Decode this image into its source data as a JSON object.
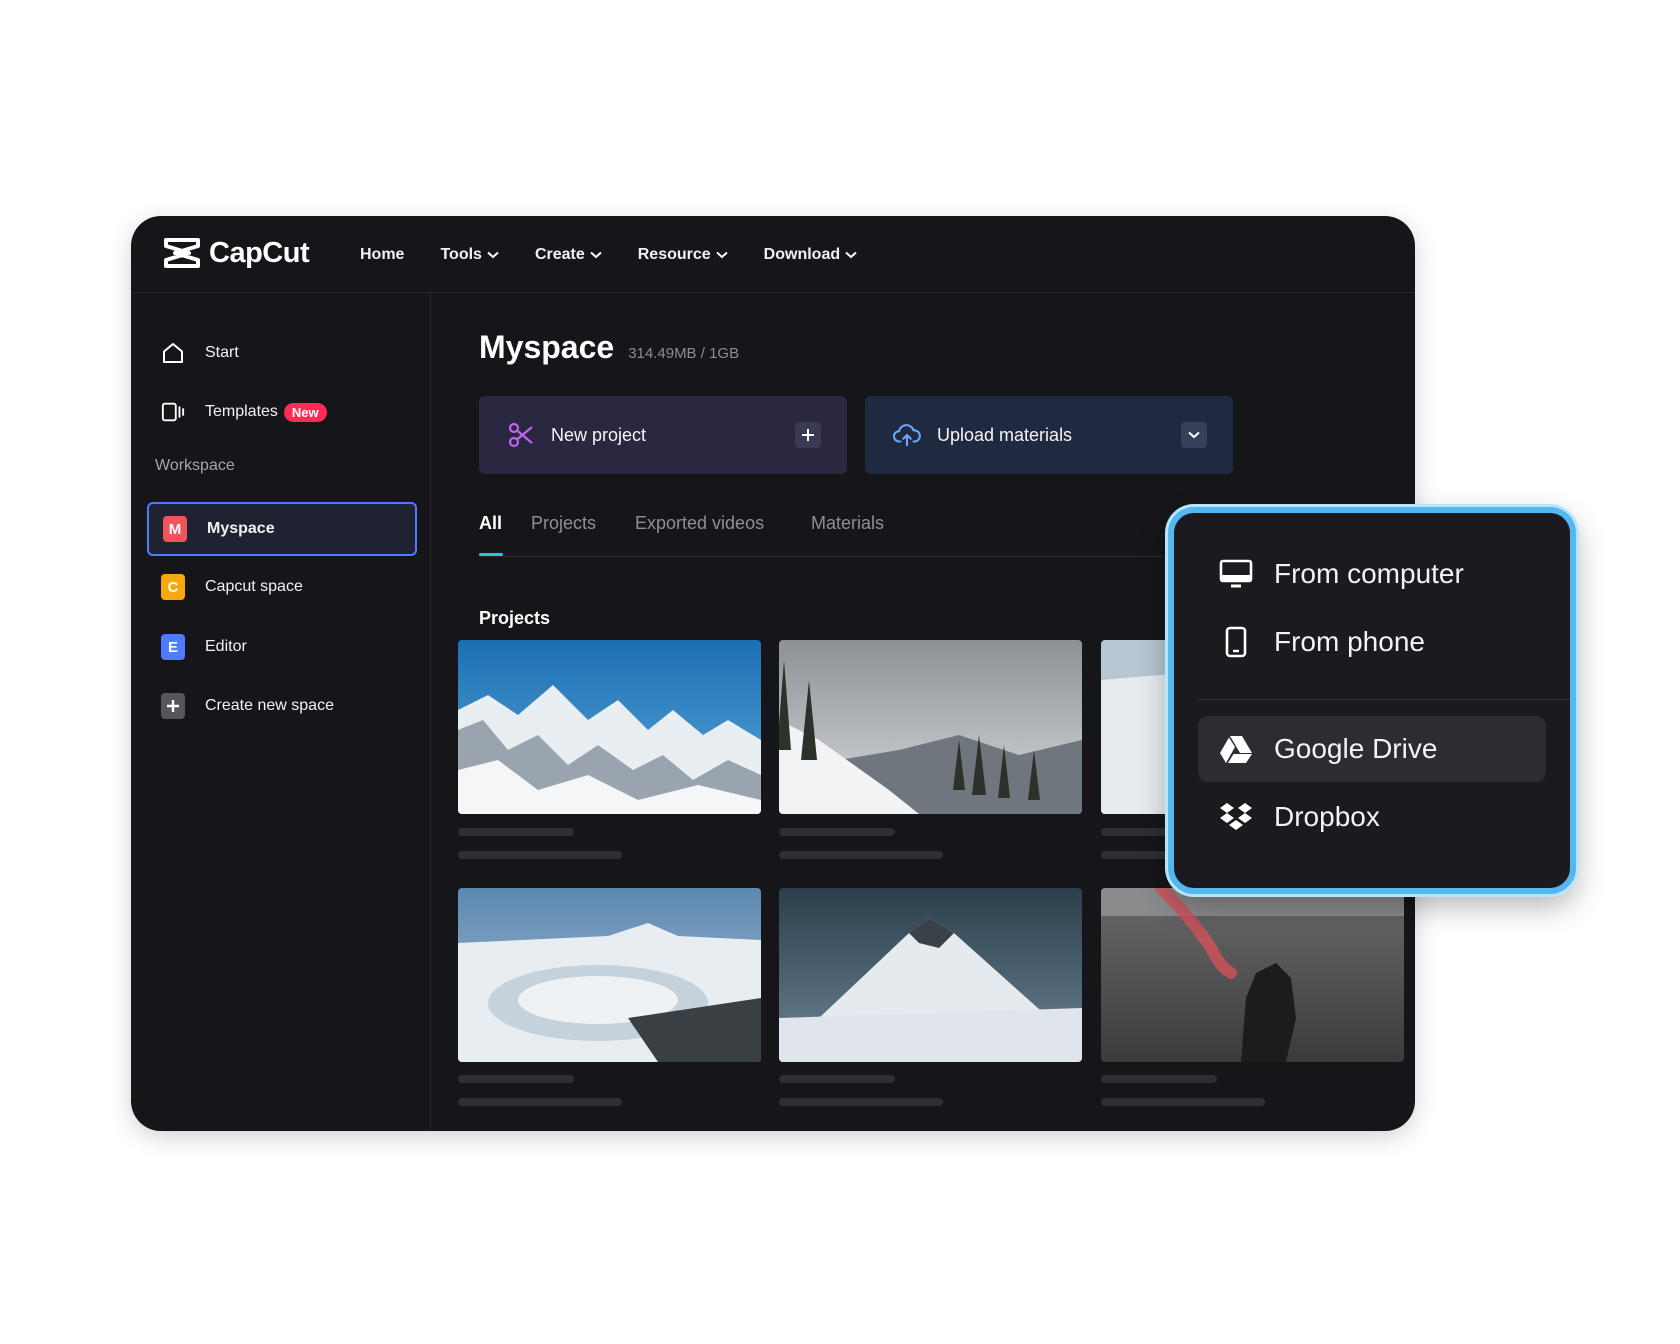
{
  "app": {
    "name": "CapCut"
  },
  "nav": {
    "home": "Home",
    "tools": "Tools",
    "create": "Create",
    "resource": "Resource",
    "download": "Download"
  },
  "sidebar": {
    "start": "Start",
    "templates": "Templates",
    "templates_badge": "New",
    "workspace_label": "Workspace",
    "spaces": [
      {
        "letter": "M",
        "label": "Myspace",
        "color": "#f2545b"
      },
      {
        "letter": "C",
        "label": "Capcut space",
        "color": "#f6a80d"
      },
      {
        "letter": "E",
        "label": "Editor",
        "color": "#4f7bff"
      }
    ],
    "create_space": "Create new space"
  },
  "main": {
    "title": "Myspace",
    "storage": "314.49MB / 1GB",
    "new_project": "New project",
    "upload_materials": "Upload materials",
    "tabs": [
      "All",
      "Projects",
      "Exported videos",
      "Materials"
    ],
    "section_label": "Projects"
  },
  "dropdown": {
    "items": [
      "From computer",
      "From phone",
      "Google Drive",
      "Dropbox"
    ]
  },
  "colors": {
    "accent": "#21c8d8",
    "active_border": "#4f7bff",
    "dropdown_border": "#55b6f0",
    "badge": "#fe2c55"
  }
}
